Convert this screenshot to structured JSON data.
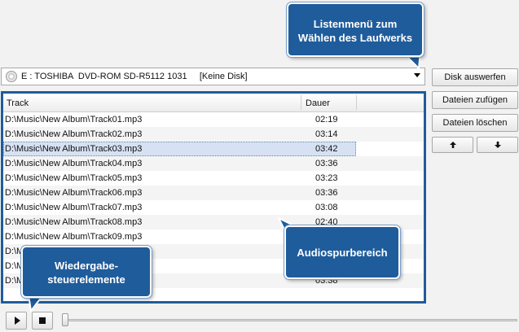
{
  "drive": {
    "label": "E : TOSHIBA  DVD-ROM SD-R5112 1031     [Keine Disk]"
  },
  "buttons": {
    "eject": "Disk auswerfen",
    "add_files": "Dateien zufügen",
    "delete_files": "Dateien löschen",
    "move_up": "🡑",
    "move_down": "🡓"
  },
  "list": {
    "columns": [
      "Track",
      "Dauer"
    ],
    "rows": [
      {
        "track": "D:\\Music\\New Album\\Track01.mp3",
        "duration": "02:19"
      },
      {
        "track": "D:\\Music\\New Album\\Track02.mp3",
        "duration": "03:14"
      },
      {
        "track": "D:\\Music\\New Album\\Track03.mp3",
        "duration": "03:42",
        "selected": true
      },
      {
        "track": "D:\\Music\\New Album\\Track04.mp3",
        "duration": "03:36"
      },
      {
        "track": "D:\\Music\\New Album\\Track05.mp3",
        "duration": "03:23"
      },
      {
        "track": "D:\\Music\\New Album\\Track06.mp3",
        "duration": "03:36"
      },
      {
        "track": "D:\\Music\\New Album\\Track07.mp3",
        "duration": "03:08"
      },
      {
        "track": "D:\\Music\\New Album\\Track08.mp3",
        "duration": "02:40"
      },
      {
        "track": "D:\\Music\\New Album\\Track09.mp3",
        "duration": ""
      },
      {
        "track": "D:\\M",
        "duration": ""
      },
      {
        "track": "D:\\M",
        "duration": ""
      },
      {
        "track": "D:\\M",
        "duration": "03:38"
      }
    ]
  },
  "callouts": {
    "drive_list": [
      "Listenmenü zum",
      "Wählen des Laufwerks"
    ],
    "audio_area": "Audiospurbereich",
    "playback": [
      "Wiedergabe-",
      "steuerelemente"
    ]
  },
  "icons": {
    "drive": "disc-icon",
    "dropdown": "chevron-down-icon",
    "play": "play-icon",
    "stop": "stop-icon",
    "up": "arrow-up-icon",
    "down": "arrow-down-icon"
  },
  "colors": {
    "accent": "#1f5c9b",
    "selection": "#d6e2f3"
  }
}
